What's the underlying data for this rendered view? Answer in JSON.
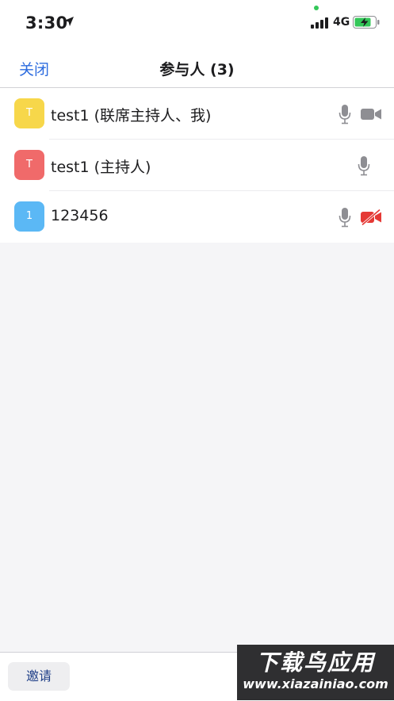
{
  "status_bar": {
    "time": "3:30",
    "network": "4G",
    "icons": [
      "location-arrow-icon",
      "signal-icon",
      "battery-charging-icon"
    ]
  },
  "nav": {
    "close_label": "关闭",
    "title": "参与人 (3)"
  },
  "participants": [
    {
      "initial": "T",
      "name": "test1 (联席主持人、我)",
      "avatar_color": "#f7d74a",
      "mic": "microphone-icon",
      "video": "video-camera-icon",
      "video_off": false
    },
    {
      "initial": "T",
      "name": "test1 (主持人)",
      "avatar_color": "#f06a6a",
      "mic": "microphone-icon",
      "video": null,
      "video_off": null
    },
    {
      "initial": "1",
      "name": "123456",
      "avatar_color": "#5bb8f5",
      "mic": "microphone-icon",
      "video": "video-off-icon",
      "video_off": true
    }
  ],
  "bottom": {
    "invite_label": "邀请"
  },
  "watermark": {
    "title": "下载鸟应用",
    "url": "www.xiazainiao.com"
  },
  "colors": {
    "accent_blue": "#2d6cdf",
    "icon_gray": "#8e8e93",
    "video_off_red": "#e53935",
    "background": "#f5f5f7"
  }
}
